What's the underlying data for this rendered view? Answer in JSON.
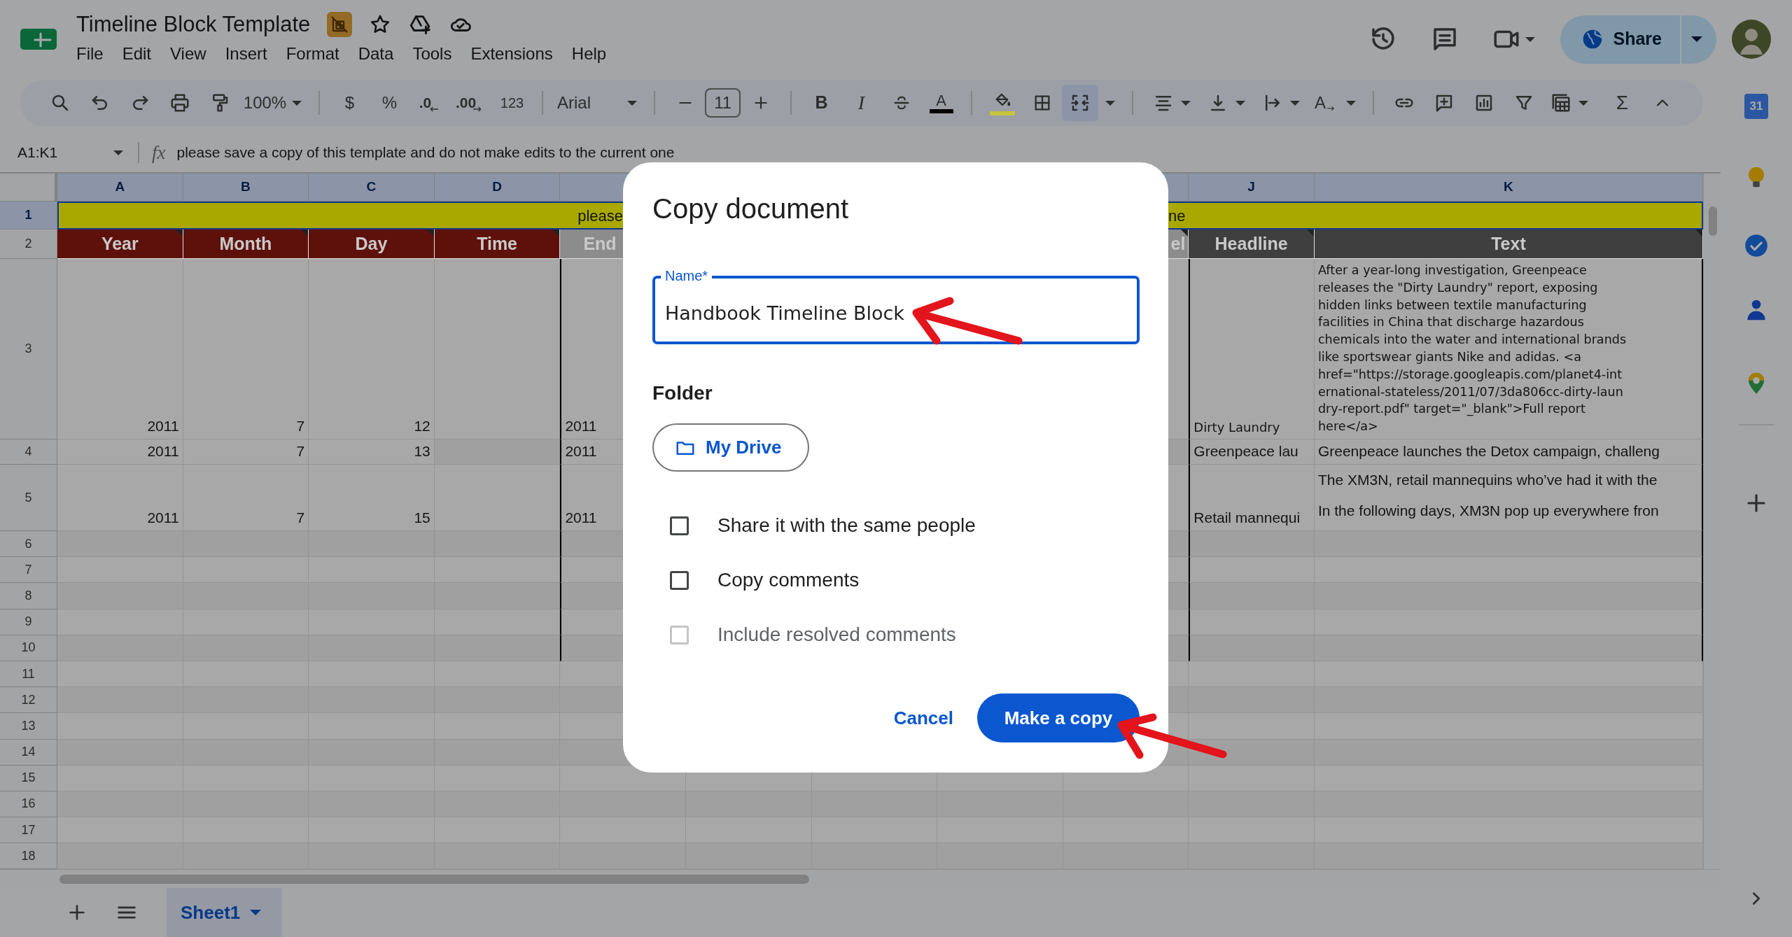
{
  "document": {
    "title": "Timeline Block Template"
  },
  "menu": [
    "File",
    "Edit",
    "View",
    "Insert",
    "Format",
    "Data",
    "Tools",
    "Extensions",
    "Help"
  ],
  "share_button": {
    "label": "Share"
  },
  "toolbar": {
    "zoom": "100%",
    "currency": "$",
    "percent": "%",
    "decrease_decimal": ".0",
    "increase_decimal": ".00",
    "number_format": "123",
    "font": "Arial",
    "font_size": "11",
    "bold": "B",
    "italic": "I",
    "text_color": {
      "label": "A",
      "color": "#000000"
    },
    "fill_color": {
      "color": "#c5c53c"
    },
    "merge": {
      "selected": true
    },
    "text_rotation": "A",
    "functions": "Σ"
  },
  "formula_bar": {
    "range": "A1:K1",
    "fx": "fx",
    "content": "please save a copy of this template and do not make edits to the current one"
  },
  "sheet": {
    "columns": {
      "A": {
        "label": "A",
        "selected": true
      },
      "B": {
        "label": "B",
        "selected": true
      },
      "C": {
        "label": "C",
        "selected": true
      },
      "D": {
        "label": "D",
        "selected": true
      },
      "J": {
        "label": "J",
        "selected": true
      },
      "K": {
        "label": "K",
        "selected": true
      }
    },
    "rows": [
      {
        "number": "1",
        "selected": true,
        "boxed": false,
        "kind": "banner",
        "banner_left": "please",
        "banner_right": "ne"
      },
      {
        "number": "2",
        "selected": false,
        "boxed": false,
        "kind": "header",
        "cells": {
          "A": {
            "text": "Year",
            "color": "#5e110b"
          },
          "B": {
            "text": "Month",
            "color": "#5e110b"
          },
          "C": {
            "text": "Day",
            "color": "#5e110b"
          },
          "D": {
            "text": "Time",
            "color": "#5e110b"
          },
          "E": {
            "text": "End",
            "color": "#8c8c8c"
          },
          "I": {
            "text": "el",
            "color": "#8c8c8c"
          },
          "J": {
            "text": "Headline",
            "color": "#3f3f3f"
          },
          "K": {
            "text": "Text",
            "color": "#3f3f3f"
          }
        }
      },
      {
        "number": "3",
        "selected": false,
        "boxed": true,
        "kind": "data",
        "cells": {
          "A": "2011",
          "B": "7",
          "C": "12",
          "E": "2011",
          "J": "Dirty Laundry",
          "K": {
            "kind": "wrapped",
            "lines": [
              "After a year-long investigation, Greenpeace",
              "releases the \"Dirty Laundry\" report, exposing",
              "hidden links between textile manufacturing",
              "facilities in China that discharge hazardous",
              "chemicals into the water and international brands",
              "like sportswear giants Nike and adidas. <a",
              "href=\"https://storage.googleapis.com/planet4-int",
              "ernational-stateless/2011/07/3da806cc-dirty-laun",
              "dry-report.pdf\" target=\"_blank\">Full report",
              "here</a>"
            ]
          }
        }
      },
      {
        "number": "4",
        "selected": false,
        "boxed": true,
        "kind": "data",
        "cells": {
          "A": "2011",
          "B": "7",
          "C": "13",
          "E": "2011",
          "J": "Greenpeace lau",
          "K": "Greenpeace launches the Detox campaign, challeng"
        }
      },
      {
        "number": "5",
        "selected": false,
        "boxed": true,
        "kind": "data",
        "cells": {
          "A": "2011",
          "B": "7",
          "C": "15",
          "E": "2011",
          "J": "Retail mannequi",
          "K": {
            "kind": "split",
            "lines": [
              "The XM3N, retail mannequins who’ve had it with the",
              "In the following days, XM3N pop up everywhere fron"
            ]
          }
        }
      },
      {
        "number": "6",
        "selected": false,
        "boxed": true,
        "kind": "data",
        "cells": {}
      },
      {
        "number": "7",
        "selected": false,
        "boxed": true,
        "kind": "data",
        "cells": {}
      },
      {
        "number": "8",
        "selected": false,
        "boxed": true,
        "kind": "data",
        "cells": {}
      },
      {
        "number": "9",
        "selected": false,
        "boxed": true,
        "kind": "data",
        "cells": {}
      },
      {
        "number": "10",
        "selected": false,
        "boxed": true,
        "kind": "data",
        "cells": {}
      },
      {
        "number": "11",
        "selected": false,
        "boxed": false,
        "kind": "data",
        "cells": {}
      },
      {
        "number": "12",
        "selected": false,
        "boxed": false,
        "kind": "data",
        "cells": {}
      },
      {
        "number": "13",
        "selected": false,
        "boxed": false,
        "kind": "data",
        "cells": {}
      },
      {
        "number": "14",
        "selected": false,
        "boxed": false,
        "kind": "data",
        "cells": {}
      },
      {
        "number": "15",
        "selected": false,
        "boxed": false,
        "kind": "data",
        "cells": {}
      },
      {
        "number": "16",
        "selected": false,
        "boxed": false,
        "kind": "data",
        "cells": {}
      },
      {
        "number": "17",
        "selected": false,
        "boxed": false,
        "kind": "data",
        "cells": {}
      },
      {
        "number": "18",
        "selected": false,
        "boxed": false,
        "kind": "data",
        "cells": {}
      }
    ]
  },
  "sheet_tabs": [
    {
      "label": "Sheet1",
      "selected": true
    }
  ],
  "side_panel": {
    "calendar": "31"
  },
  "dialog": {
    "title": "Copy document",
    "name_field": {
      "label": "Name*",
      "value": "Handbook Timeline Block"
    },
    "folder_label": "Folder",
    "folder_button": "My Drive",
    "options": [
      {
        "label": "Share it with the same people",
        "checked": false,
        "disabled": false
      },
      {
        "label": "Copy comments",
        "checked": false,
        "disabled": false
      },
      {
        "label": "Include resolved comments",
        "checked": false,
        "disabled": true
      }
    ],
    "cancel": "Cancel",
    "confirm": "Make a copy"
  }
}
